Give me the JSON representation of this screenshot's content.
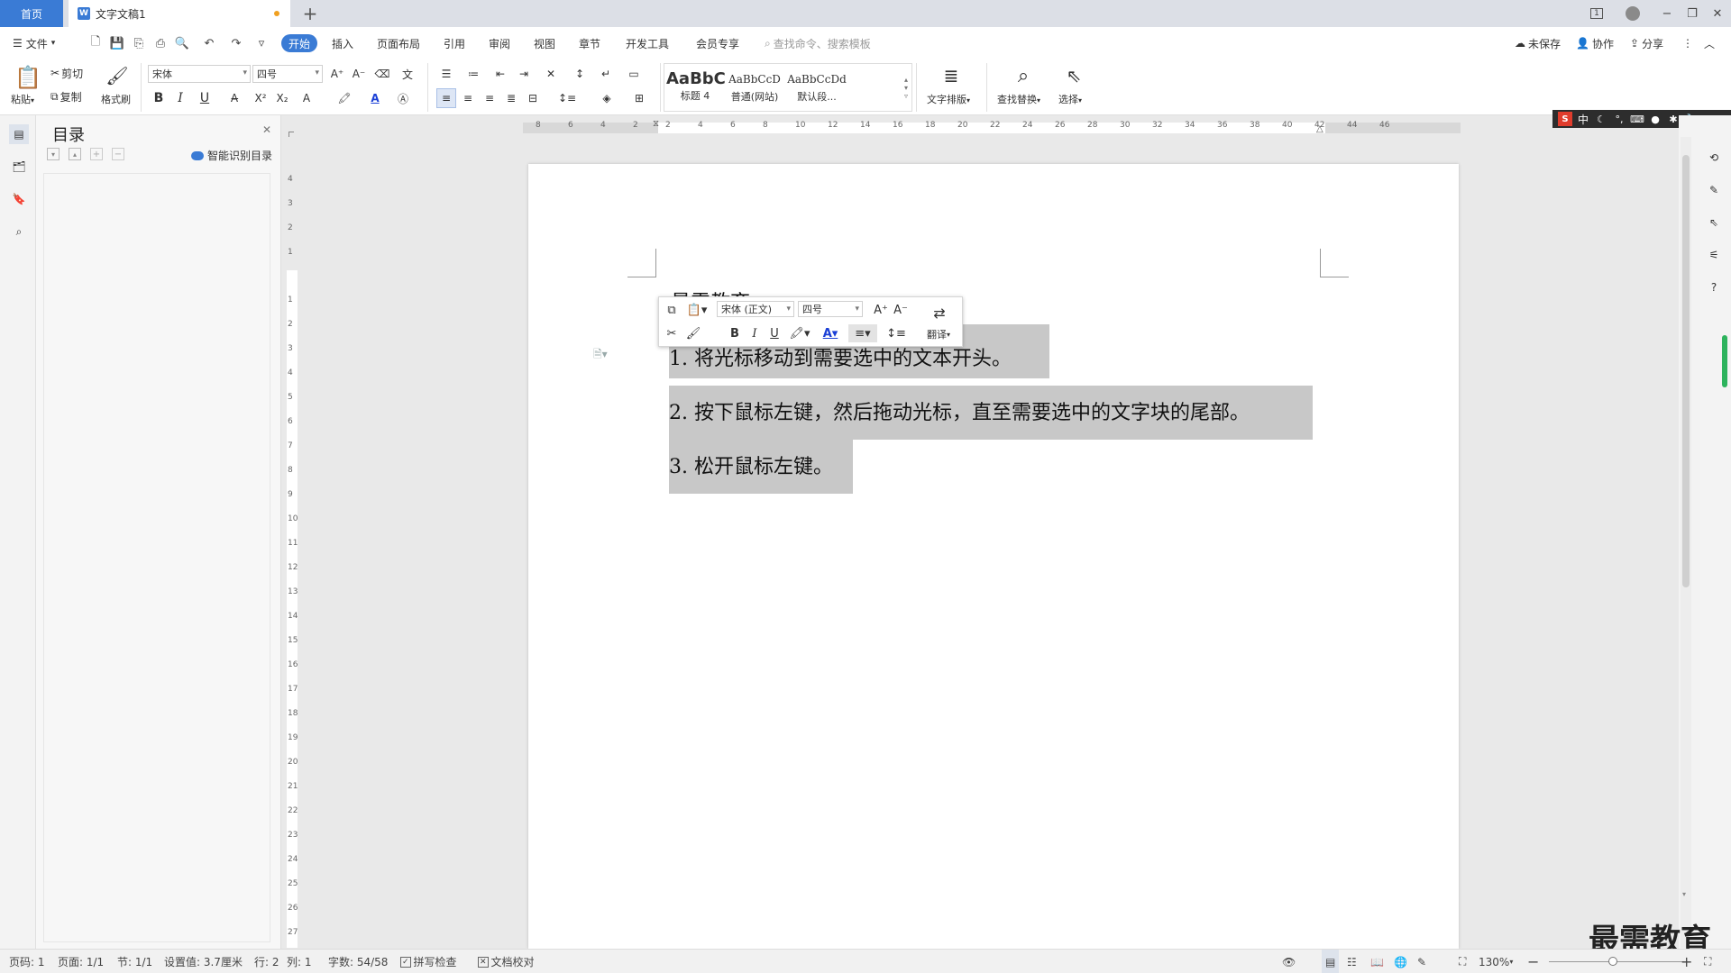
{
  "tabs": {
    "home": "首页",
    "doc": "文字文稿1",
    "new": "+"
  },
  "window": {
    "layout_badge": "1",
    "minimize": "−",
    "restore": "❐",
    "close": "✕"
  },
  "menu": {
    "file": "文件",
    "items": [
      "开始",
      "插入",
      "页面布局",
      "引用",
      "审阅",
      "视图",
      "章节",
      "开发工具",
      "会员专享"
    ],
    "search_placeholder": "查找命令、搜索模板",
    "unsaved": "未保存",
    "collab": "协作",
    "share": "分享"
  },
  "ribbon": {
    "paste": "粘贴",
    "cut": "剪切",
    "copy": "复制",
    "format_painter": "格式刷",
    "font_name": "宋体",
    "font_size": "四号",
    "bold": "B",
    "italic": "I",
    "underline": "U",
    "styles": [
      {
        "sample": "AaBbC",
        "label": "标题 4"
      },
      {
        "sample": "AaBbCcD",
        "label": "普通(网站)"
      },
      {
        "sample": "AaBbCcDd",
        "label": "默认段..."
      }
    ],
    "text_layout": "文字排版",
    "find_replace": "查找替换",
    "select": "选择"
  },
  "nav": {
    "title": "目录",
    "smart": "智能识别目录"
  },
  "ruler": {
    "h": [
      "8",
      "6",
      "4",
      "2",
      "2",
      "4",
      "6",
      "8",
      "10",
      "12",
      "14",
      "16",
      "18",
      "20",
      "22",
      "24",
      "26",
      "28",
      "30",
      "32",
      "34",
      "36",
      "38",
      "40",
      "42",
      "44",
      "46"
    ],
    "v_top": [
      "4",
      "3",
      "2",
      "1"
    ],
    "v": [
      "1",
      "2",
      "3",
      "4",
      "5",
      "6",
      "7",
      "8",
      "9",
      "10",
      "11",
      "12",
      "13",
      "14",
      "15",
      "16",
      "17",
      "18",
      "19",
      "20",
      "21",
      "22",
      "23",
      "24",
      "25",
      "26",
      "27"
    ]
  },
  "document": {
    "heading": "最需教育",
    "lines": [
      "1. 将光标移动到需要选中的文本开头。",
      "2. 按下鼠标左键，然后拖动光标，直至需要选中的文字块的尾部。",
      "3. 松开鼠标左键。"
    ]
  },
  "mini_toolbar": {
    "font": "宋体 (正文)",
    "size": "四号",
    "translate": "翻译"
  },
  "ime": {
    "mode": "中"
  },
  "status": {
    "page_num": "页码: 1",
    "page": "页面: 1/1",
    "section": "节: 1/1",
    "setting": "设置值: 3.7厘米",
    "row": "行: 2",
    "col": "列: 1",
    "words": "字数: 54/58",
    "spell": "拼写检查",
    "proof": "文档校对",
    "zoom": "130%"
  },
  "watermark": "最需教育",
  "colors": {
    "accent": "#3a7bd5",
    "selection": "#c8c8c8",
    "unsaved_dot": "#f0a020",
    "scroll_green": "#2db35d"
  }
}
